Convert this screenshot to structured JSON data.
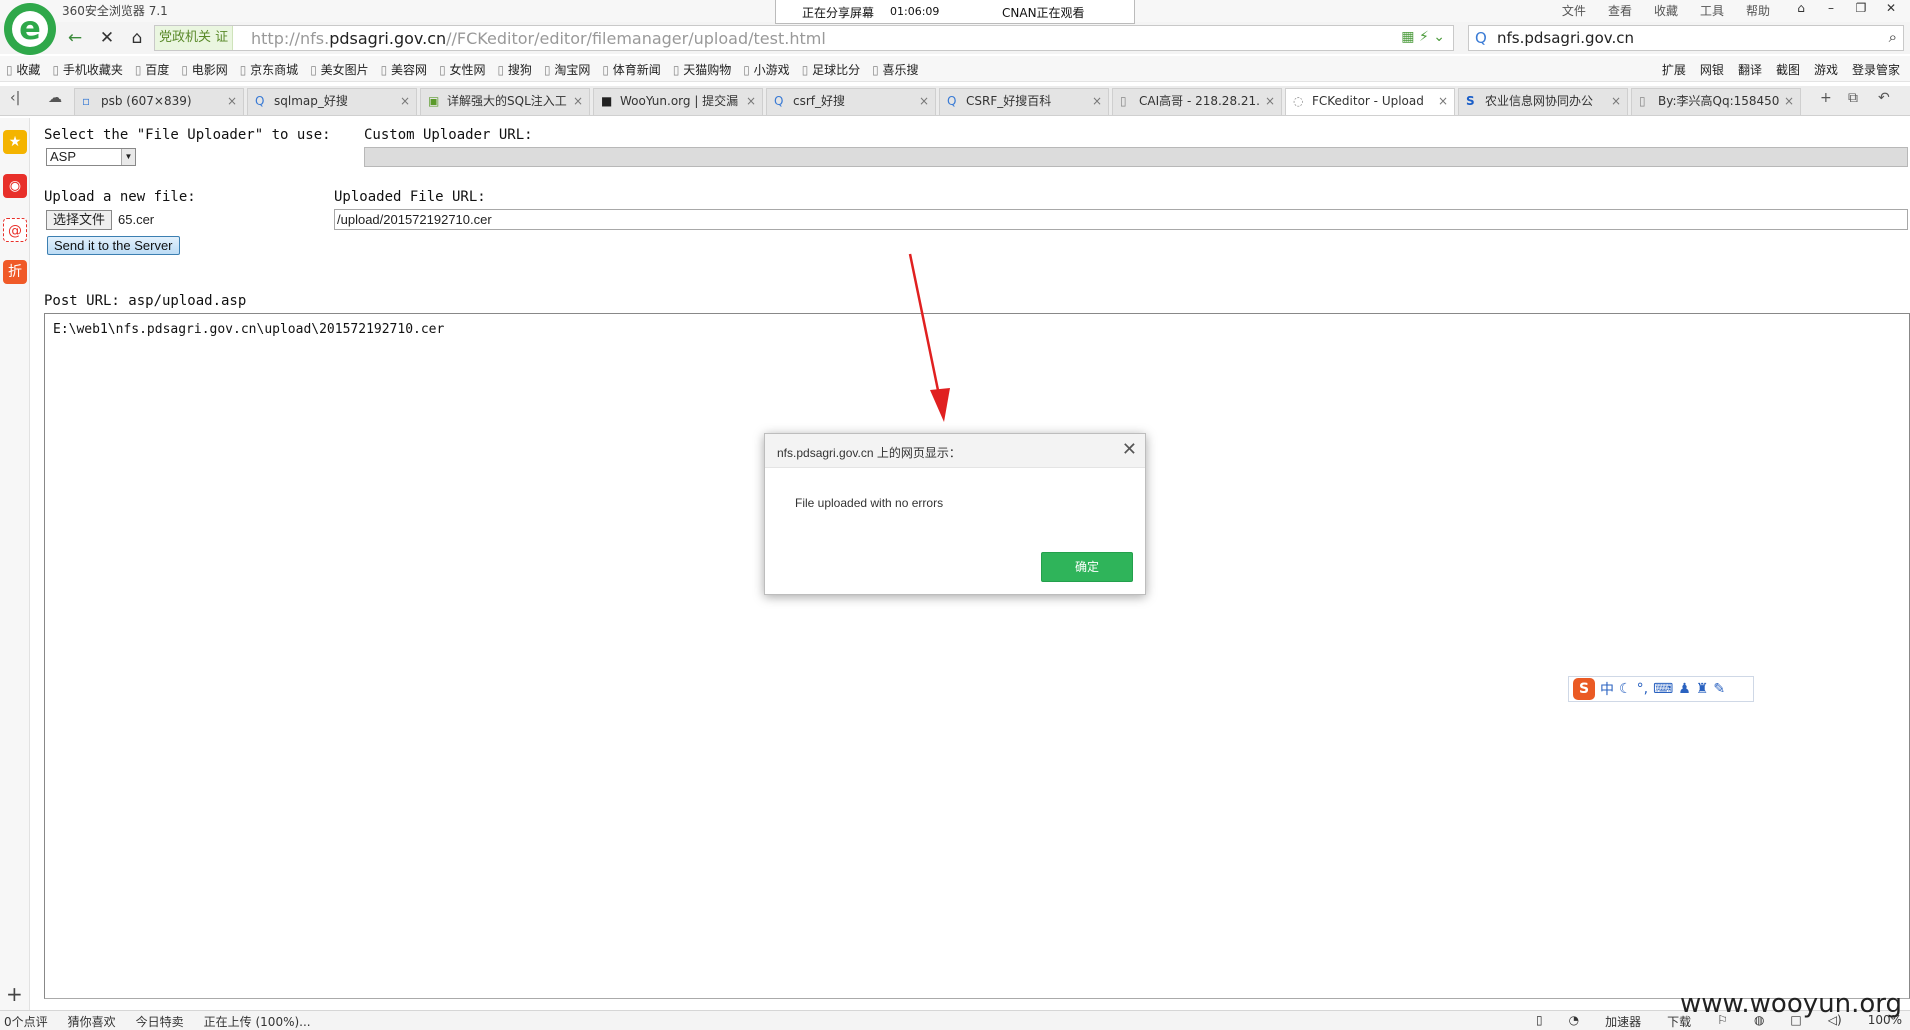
{
  "browser": {
    "app_title": "360安全浏览器 7.1",
    "logo_letter": "e",
    "share": {
      "status": "正在分享屏幕",
      "timer": "01:06:09",
      "viewer": "CNAN正在观看"
    },
    "menu": [
      "文件",
      "查看",
      "收藏",
      "工具",
      "帮助"
    ],
    "gov_badge": "党政机关 证",
    "url_prefix": "http://nfs.",
    "url_domain": "pdsagri.gov.cn",
    "url_path": "//FCKeditor/editor/filemanager/upload/test.html",
    "search_text": "nfs.pdsagri.gov.cn",
    "bookmarks": [
      "收藏",
      "手机收藏夹",
      "百度",
      "电影网",
      "京东商城",
      "美女图片",
      "美容网",
      "女性网",
      "搜狗",
      "淘宝网",
      "体育新闻",
      "天猫购物",
      "小游戏",
      "足球比分",
      "喜乐搜"
    ],
    "bookmarks_right": [
      "扩展",
      "网银",
      "翻译",
      "截图",
      "游戏",
      "登录管家"
    ],
    "tabs": [
      {
        "label": "psb (607×839)",
        "active": false
      },
      {
        "label": "sqlmap_好搜",
        "active": false
      },
      {
        "label": "详解强大的SQL注入工",
        "active": false
      },
      {
        "label": "WooYun.org | 提交漏",
        "active": false
      },
      {
        "label": "csrf_好搜",
        "active": false
      },
      {
        "label": "CSRF_好搜百科",
        "active": false
      },
      {
        "label": "CAI高哥 - 218.28.21.",
        "active": false
      },
      {
        "label": "FCKeditor - Upload",
        "active": true
      },
      {
        "label": "农业信息网协同办公",
        "active": false
      },
      {
        "label": "By:李兴高Qq:158450",
        "active": false
      }
    ]
  },
  "page": {
    "select_label": "Select the \"File Uploader\" to use:",
    "select_value": "ASP",
    "custom_url_label": "Custom Uploader URL:",
    "upload_label": "Upload a new file:",
    "file_button": "选择文件",
    "file_name": "65.cer",
    "uploaded_url_label": "Uploaded File URL:",
    "uploaded_url_value": "/upload/201572192710.cer",
    "send_button": "Send it to the Server",
    "post_url": "Post URL: asp/upload.asp",
    "output_text": "E:\\web1\\nfs.pdsagri.gov.cn\\upload\\201572192710.cer"
  },
  "dialog": {
    "title": "nfs.pdsagri.gov.cn 上的网页显示：",
    "message": "File uploaded with no errors",
    "ok_label": "确定"
  },
  "statusbar": {
    "comments": "0个点评",
    "guess": "猜你喜欢",
    "deals": "今日特卖",
    "loading": "正在上传 (100%)...",
    "accelerator": "加速器",
    "download": "下载",
    "zoom": "100%"
  },
  "watermark": "www.wooyun.org",
  "colors": {
    "accent_green": "#2fb45a",
    "arrow_red": "#e02020",
    "send_button": "#bcdcf5"
  }
}
